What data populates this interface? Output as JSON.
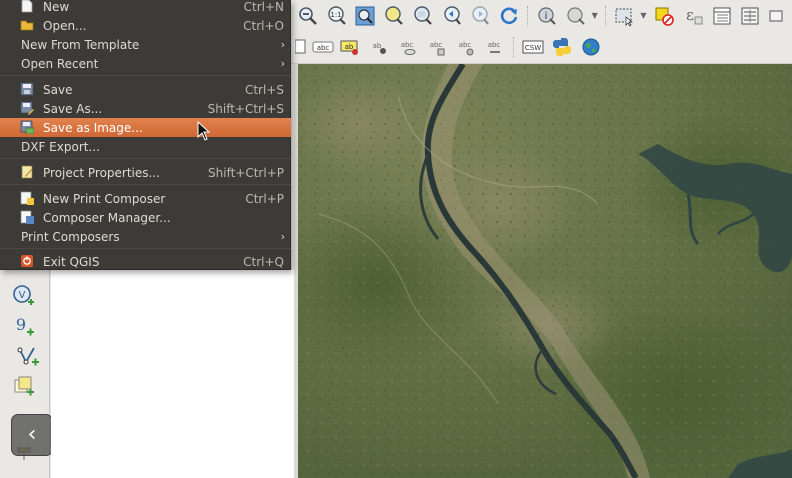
{
  "file_menu": {
    "items": [
      {
        "label": "New",
        "shortcut": "Ctrl+N",
        "icon": "new-file-icon"
      },
      {
        "label": "Open...",
        "shortcut": "Ctrl+O",
        "icon": "open-folder-icon"
      },
      {
        "label": "New From Template",
        "submenu": true
      },
      {
        "label": "Open Recent",
        "submenu": true
      },
      {
        "label": "Save",
        "shortcut": "Ctrl+S",
        "icon": "save-icon"
      },
      {
        "label": "Save As...",
        "shortcut": "Shift+Ctrl+S",
        "icon": "save-as-icon"
      },
      {
        "label": "Save as Image...",
        "icon": "save-as-image-icon",
        "highlighted": true
      },
      {
        "label": "DXF Export..."
      },
      {
        "label": "Project Properties...",
        "shortcut": "Shift+Ctrl+P",
        "icon": "project-properties-icon"
      },
      {
        "label": "New Print Composer",
        "shortcut": "Ctrl+P",
        "icon": "new-composer-icon"
      },
      {
        "label": "Composer Manager...",
        "icon": "composer-manager-icon"
      },
      {
        "label": "Print Composers",
        "submenu": true
      },
      {
        "label": "Exit QGIS",
        "shortcut": "Ctrl+Q",
        "icon": "exit-icon"
      }
    ],
    "submenu_arrow": "›"
  },
  "toolbar": {
    "label_tool_csw": "CSW",
    "label_tool_abc": "abc",
    "label_tool_ab": "ab",
    "zoom_native": "1:1"
  },
  "panel": {
    "collapse_glyph": "‹"
  },
  "colors": {
    "menu_bg": "#3c3b37",
    "menu_highlight": "#dd7a45",
    "toolbar_bg": "#e9e8e4",
    "river": "#2c3b3b",
    "terrain": "#6a7448"
  }
}
